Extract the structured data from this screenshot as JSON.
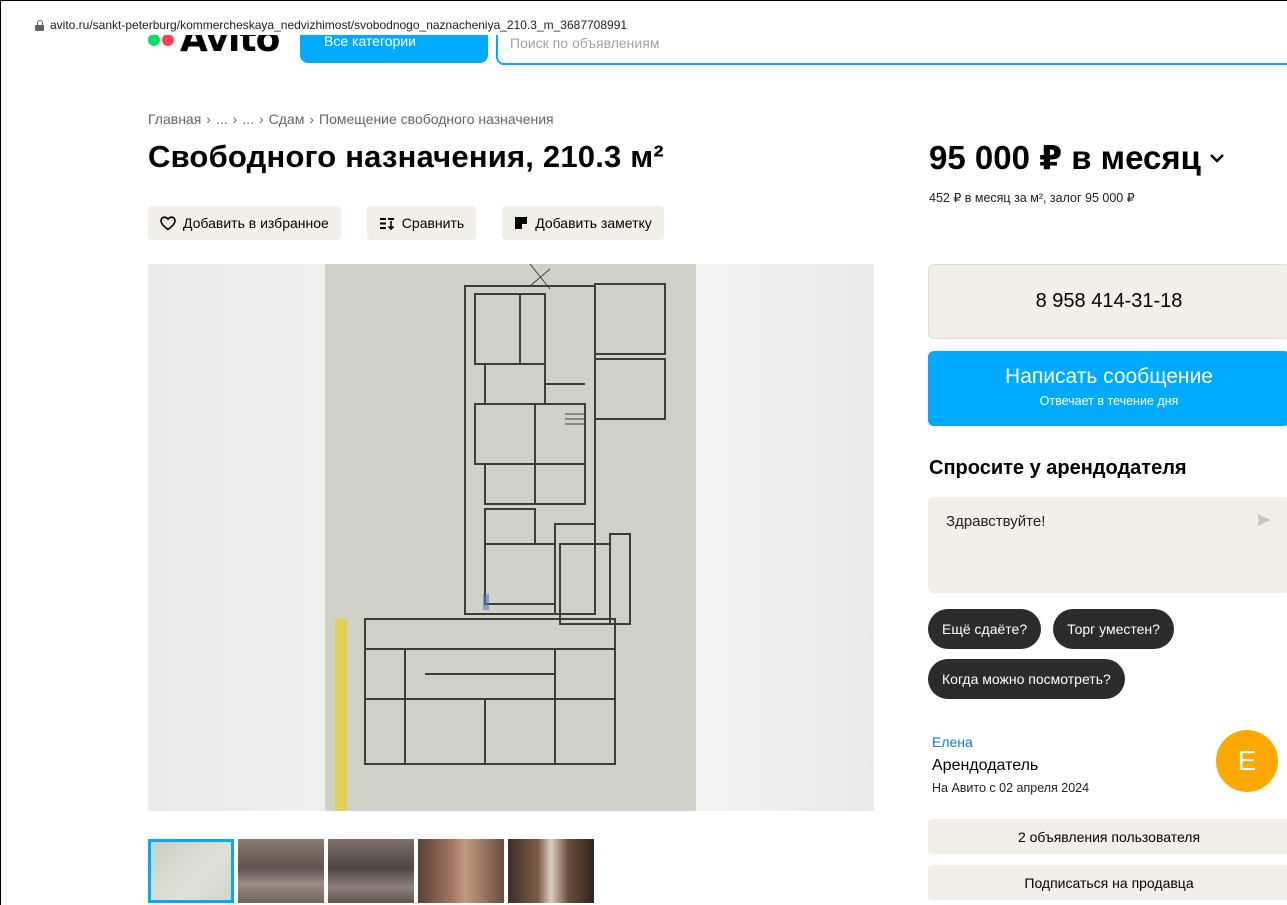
{
  "browser": {
    "url": "avito.ru/sankt-peterburg/kommercheskaya_nedvizhimost/svobodnogo_naznacheniya_210.3_m_3687708991"
  },
  "header": {
    "logo_text": "Avito",
    "logo_dot_colors": [
      "#04e061",
      "#ff4053"
    ],
    "categories_label": "Все категории",
    "search_placeholder": "Поиск по объявлениям"
  },
  "breadcrumb": {
    "items": [
      "Главная",
      "...",
      "...",
      "Сдам",
      "Помещение свободного назначения"
    ],
    "separator": "›"
  },
  "listing": {
    "title": "Свободного назначения, 210.3 м²",
    "actions": {
      "favorite": "Добавить в избранное",
      "compare": "Сравнить",
      "note": "Добавить заметку"
    }
  },
  "gallery": {
    "thumb_count": 5,
    "active_thumb": 0
  },
  "pricing": {
    "price": "95 000 ₽ в месяц",
    "details": "452 ₽ в месяц за м², залог 95 000 ₽"
  },
  "contact": {
    "phone": "8 958 414-31-18",
    "message_label": "Написать сообщение",
    "message_sub": "Отвечает в течение дня"
  },
  "ask": {
    "title": "Спросите у арендодателя",
    "input_value": "Здравствуйте!",
    "chips": [
      "Ещё сдаёте?",
      "Торг уместен?",
      "Когда можно посмотреть?"
    ]
  },
  "seller": {
    "name": "Елена",
    "role": "Арендодатель",
    "since": "На Авито с 02 апреля 2024",
    "avatar_letter": "E",
    "ads_button": "2 объявления пользователя",
    "subscribe_button": "Подписаться на продавца"
  },
  "colors": {
    "accent": "#00aaff",
    "chip_bg": "#2b2b2b",
    "button_bg": "#f2efe9",
    "avatar_bg": "#ffa900",
    "link": "#0a7ed1"
  }
}
